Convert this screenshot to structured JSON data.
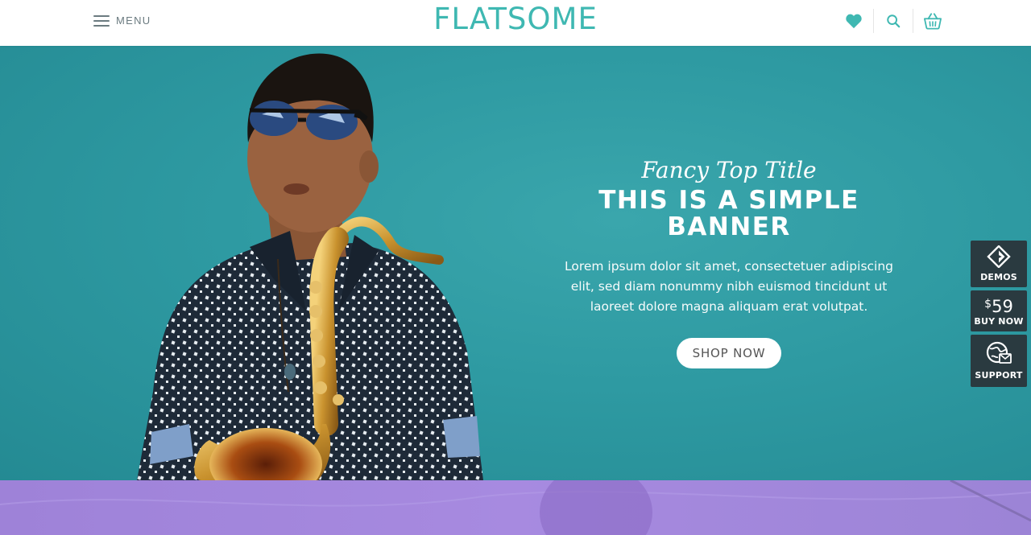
{
  "header": {
    "menu_label": "MENU",
    "logo_text": "FLATSOME",
    "icons": [
      "heart-icon",
      "search-icon",
      "basket-icon"
    ]
  },
  "banner": {
    "fancy_title": "Fancy Top Title",
    "title_line1": "THIS IS A SIMPLE",
    "title_line2": "BANNER",
    "description": "Lorem ipsum dolor sit amet, consectetuer adipiscing elit, sed diam nonummy nibh euismod tincidunt ut laoreet dolore magna aliquam erat volutpat.",
    "button_label": "SHOP NOW"
  },
  "side_widgets": {
    "demos_label": "DEMOS",
    "price_currency": "$",
    "price_value": "59",
    "buy_label": "BUY NOW",
    "support_label": "SUPPORT"
  },
  "colors": {
    "accent": "#3fb8b2",
    "hero_bg": "#2e9aa2",
    "widget_bg": "#2a3a40",
    "next_section": "#a78ae0"
  }
}
